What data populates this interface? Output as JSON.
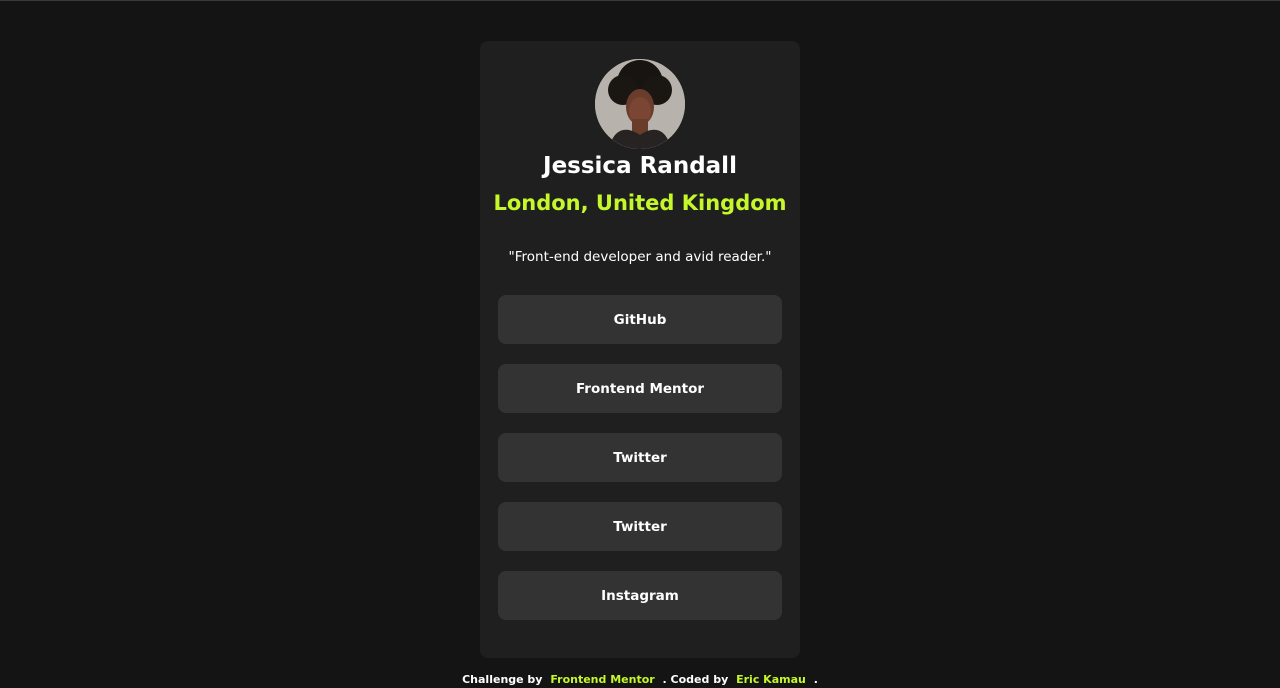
{
  "profile": {
    "name": "Jessica Randall",
    "location": "London, United Kingdom",
    "bio": "\"Front-end developer and avid reader.\"",
    "avatar_icon": "profile-photo"
  },
  "links": [
    {
      "label": "GitHub"
    },
    {
      "label": "Frontend Mentor"
    },
    {
      "label": "Twitter"
    },
    {
      "label": "Twitter"
    },
    {
      "label": "Instagram"
    }
  ],
  "footer": {
    "challenge_by": "Challenge by",
    "challenge_link": "Frontend Mentor",
    "coded_by": ". Coded by",
    "author_link": "Eric Kamau",
    "end": "."
  },
  "colors": {
    "page_bg": "#141414",
    "card_bg": "#1f1f1f",
    "button_bg": "#333333",
    "accent": "#c4f82a",
    "text": "#ffffff"
  }
}
